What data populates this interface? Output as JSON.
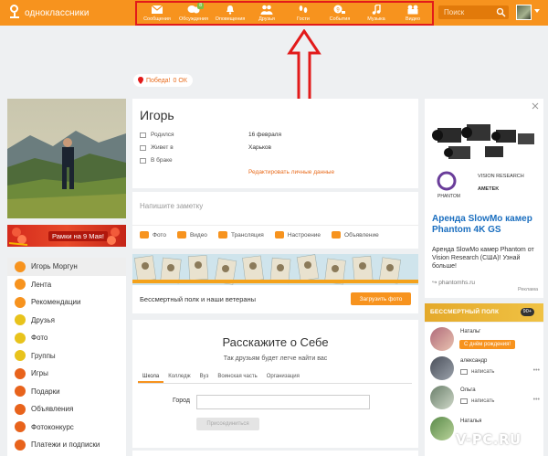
{
  "topbar": {
    "logo_text": "одноклассники",
    "nav": [
      {
        "label": "Сообщения",
        "icon": "envelope-icon",
        "badge": ""
      },
      {
        "label": "Обсуждения",
        "icon": "chat-icon",
        "badge": "8"
      },
      {
        "label": "Оповещения",
        "icon": "bell-icon",
        "badge": ""
      },
      {
        "label": "Друзья",
        "icon": "friends-icon",
        "badge": ""
      },
      {
        "label": "Гости",
        "icon": "footprints-icon",
        "badge": ""
      },
      {
        "label": "События",
        "icon": "events-icon",
        "badge": ""
      },
      {
        "label": "Музыка",
        "icon": "music-icon",
        "badge": ""
      },
      {
        "label": "Видео",
        "icon": "video-icon",
        "badge": ""
      }
    ],
    "search_placeholder": "Поиск"
  },
  "pill": {
    "label": "Победа!",
    "count": "0 ОК"
  },
  "banner": {
    "label": "Рамки на 9 Мая!"
  },
  "left_menu": [
    {
      "label": "Игорь Моргун",
      "color": "#f7931e"
    },
    {
      "label": "Лента",
      "color": "#f7931e"
    },
    {
      "label": "Рекомендации",
      "color": "#f7931e"
    },
    {
      "label": "Друзья",
      "color": "#e8c31c"
    },
    {
      "label": "Фото",
      "color": "#e8c31c"
    },
    {
      "label": "Группы",
      "color": "#e8c31c"
    },
    {
      "label": "Игры",
      "color": "#e8631c"
    },
    {
      "label": "Подарки",
      "color": "#e8631c"
    },
    {
      "label": "Объявления",
      "color": "#e8631c"
    },
    {
      "label": "Фотоконкурс",
      "color": "#e8631c"
    },
    {
      "label": "Платежи и подписки",
      "color": "#e8631c"
    }
  ],
  "profile": {
    "name": "Игорь",
    "rows": [
      {
        "label": "Родился",
        "value": "16 февраля"
      },
      {
        "label": "Живет в",
        "value": "Харьков"
      },
      {
        "label": "В браке",
        "value": ""
      }
    ],
    "edit_link": "Редактировать личные данные"
  },
  "note": {
    "placeholder": "Напишите заметку",
    "actions": [
      "Фото",
      "Видео",
      "Трансляция",
      "Настроение",
      "Объявление"
    ]
  },
  "regiment": {
    "text": "Бессмертный полк и наши ветераны",
    "button": "Загрузить фото"
  },
  "about": {
    "title": "Расскажите о Себе",
    "subtitle": "Так друзьям будет легче найти вас",
    "tabs": [
      "Школа",
      "Колледж",
      "Вуз",
      "Воинская часть",
      "Организация"
    ],
    "field_label": "Город",
    "button": "Присоединиться"
  },
  "ad": {
    "brand": "PHANTOM",
    "brand2": "VISION RESEARCH",
    "brand3": "AMETEK",
    "title": "Аренда SlowMo камер Phantom 4K GS",
    "description": "Аренда SlowMo камер Phantom от Vision Research (США)! Узнай больше!",
    "link": "phantomhs.ru",
    "mark": "Реклама"
  },
  "polk": {
    "text": "БЕССМЕРТНЫЙ ПОЛК",
    "badge": "90+"
  },
  "friends": [
    {
      "name": "Натальг",
      "action": "С днём рождения!",
      "type": "bday"
    },
    {
      "name": "александр",
      "action": "написать",
      "type": "msg"
    },
    {
      "name": "Ольга",
      "action": "написать",
      "type": "msg"
    },
    {
      "name": "Наталья",
      "action": "",
      "type": "msg"
    }
  ],
  "watermark": "V-PC.RU"
}
